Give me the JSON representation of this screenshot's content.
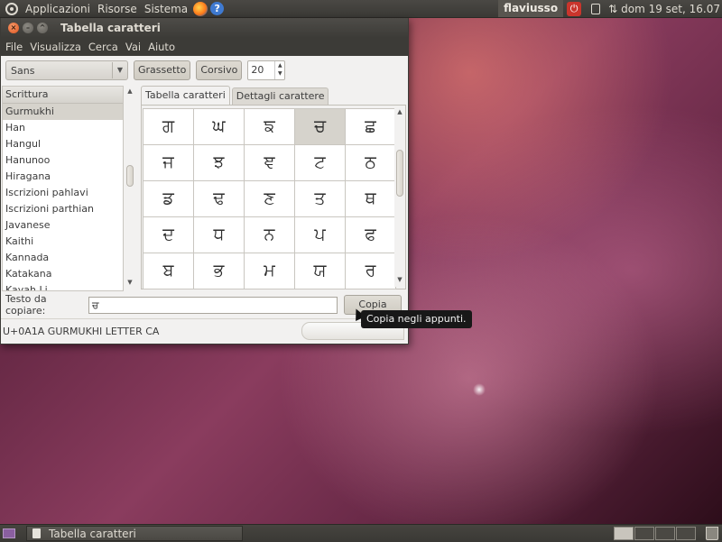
{
  "top_panel": {
    "menus": [
      "Applicazioni",
      "Risorse",
      "Sistema"
    ],
    "user": "flaviusso",
    "clock": "dom 19 set, 16.07"
  },
  "window": {
    "title": "Tabella caratteri",
    "menu": [
      "File",
      "Visualizza",
      "Cerca",
      "Vai",
      "Aiuto"
    ],
    "toolbar": {
      "font": "Sans",
      "bold_label": "Grassetto",
      "italic_label": "Corsivo",
      "size": "20"
    },
    "script_list": {
      "header": "Scrittura",
      "items": [
        "Gurmukhi",
        "Han",
        "Hangul",
        "Hanunoo",
        "Hiragana",
        "Iscrizioni pahlavi",
        "Iscrizioni parthian",
        "Javanese",
        "Kaithi",
        "Kannada",
        "Katakana",
        "Kayah Li"
      ],
      "selected_index": 0
    },
    "tabs": [
      "Tabella caratteri",
      "Dettagli carattere"
    ],
    "active_tab": 0,
    "characters": [
      [
        "ਗ",
        "ਘ",
        "ਙ",
        "ਚ",
        "ਛ"
      ],
      [
        "ਜ",
        "ਝ",
        "ਞ",
        "ਟ",
        "ਠ"
      ],
      [
        "ਡ",
        "ਢ",
        "ਣ",
        "ਤ",
        "ਥ"
      ],
      [
        "ਦ",
        "ਧ",
        "ਨ",
        "ਪ",
        "ਫ"
      ],
      [
        "ਬ",
        "ਭ",
        "ਮ",
        "ਯ",
        "ਰ"
      ]
    ],
    "selected_cell": [
      0,
      3
    ],
    "copy": {
      "label": "Testo da copiare:",
      "value": "ਚ",
      "button": "Copia"
    },
    "status": "U+0A1A GURMUKHI LETTER CA",
    "tooltip": "Copia negli appunti."
  },
  "taskbar": {
    "task_label": "Tabella caratteri"
  }
}
